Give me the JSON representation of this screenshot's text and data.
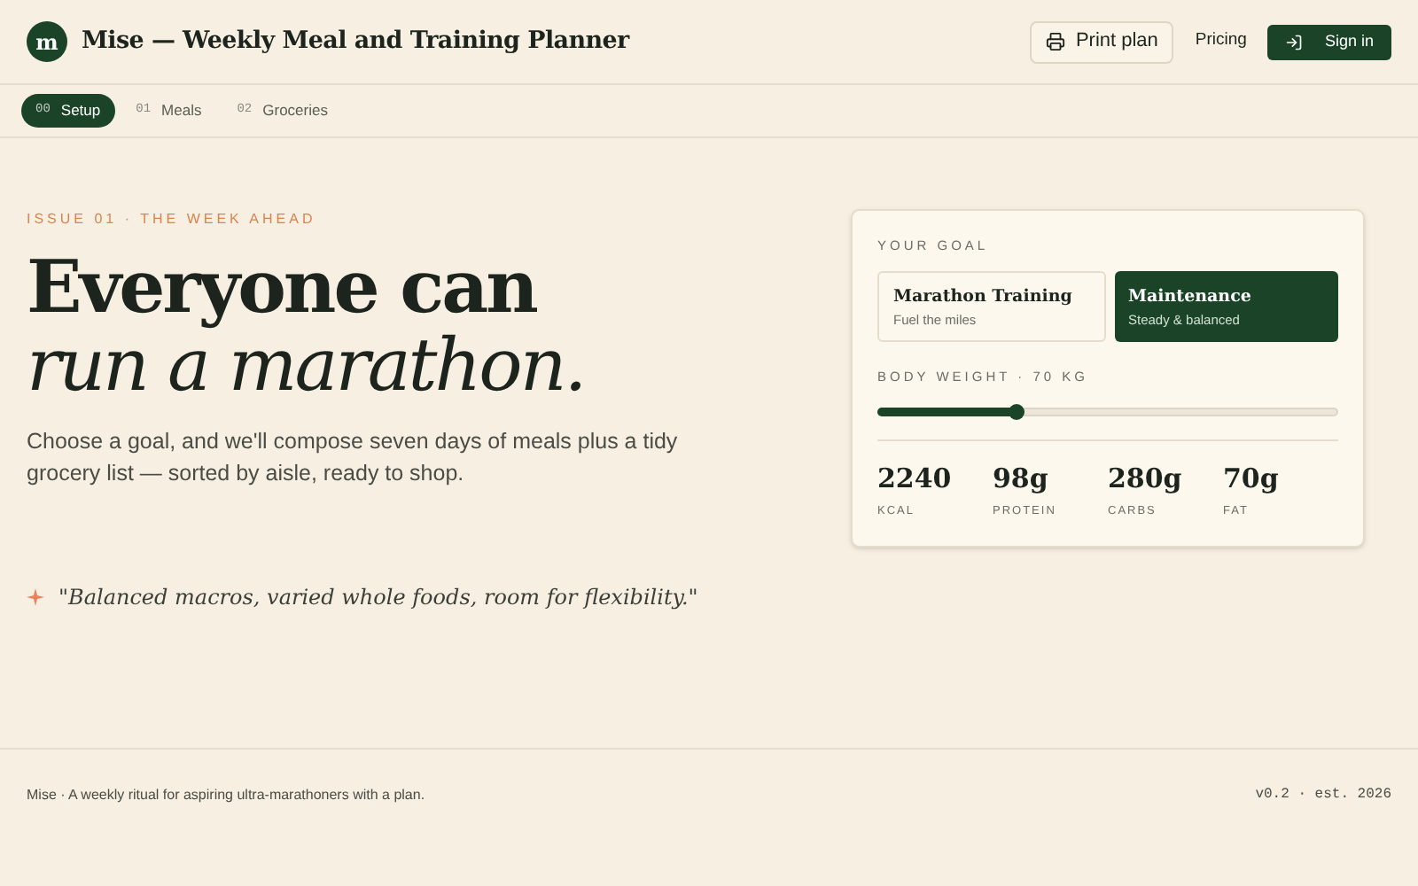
{
  "header": {
    "logo": "m",
    "title": "Mise — Weekly Meal and Training Planner",
    "print_button": "Print plan",
    "pricing_link": "Pricing",
    "sign_in_button": "Sign in"
  },
  "tabs": [
    {
      "number": "00",
      "label": "Setup",
      "selected": true
    },
    {
      "number": "01",
      "label": "Meals",
      "selected": false
    },
    {
      "number": "02",
      "label": "Groceries",
      "selected": false
    }
  ],
  "hero": {
    "eyebrow": "ISSUE 01 · THE WEEK AHEAD",
    "headline": "Everyone can",
    "headline_italic": "run a marathon.",
    "intro": "Choose a goal, and we'll compose seven days of meals plus a tidy grocery list — sorted by aisle, ready to shop.",
    "quote": "\"Balanced macros, varied whole foods, room for flexibility.\""
  },
  "goal_card": {
    "label": "YOUR GOAL",
    "goals": [
      {
        "title": "Marathon Training",
        "subtitle": "Fuel the miles",
        "selected": false
      },
      {
        "title": "Maintenance",
        "subtitle": "Steady & balanced",
        "selected": true
      }
    ],
    "weight_label": "BODY WEIGHT · 70 KG",
    "weight": {
      "level": 0.3
    },
    "stats": [
      {
        "value": "2240",
        "label": "KCAL"
      },
      {
        "value": "98g",
        "label": "PROTEIN"
      },
      {
        "value": "280g",
        "label": "CARBS"
      },
      {
        "value": "70g",
        "label": "FAT"
      }
    ]
  },
  "footer": {
    "tagline": "Mise · A weekly ritual for aspiring ultra-marathoners with a plan.",
    "version": "v0.2 · est. 2026"
  }
}
